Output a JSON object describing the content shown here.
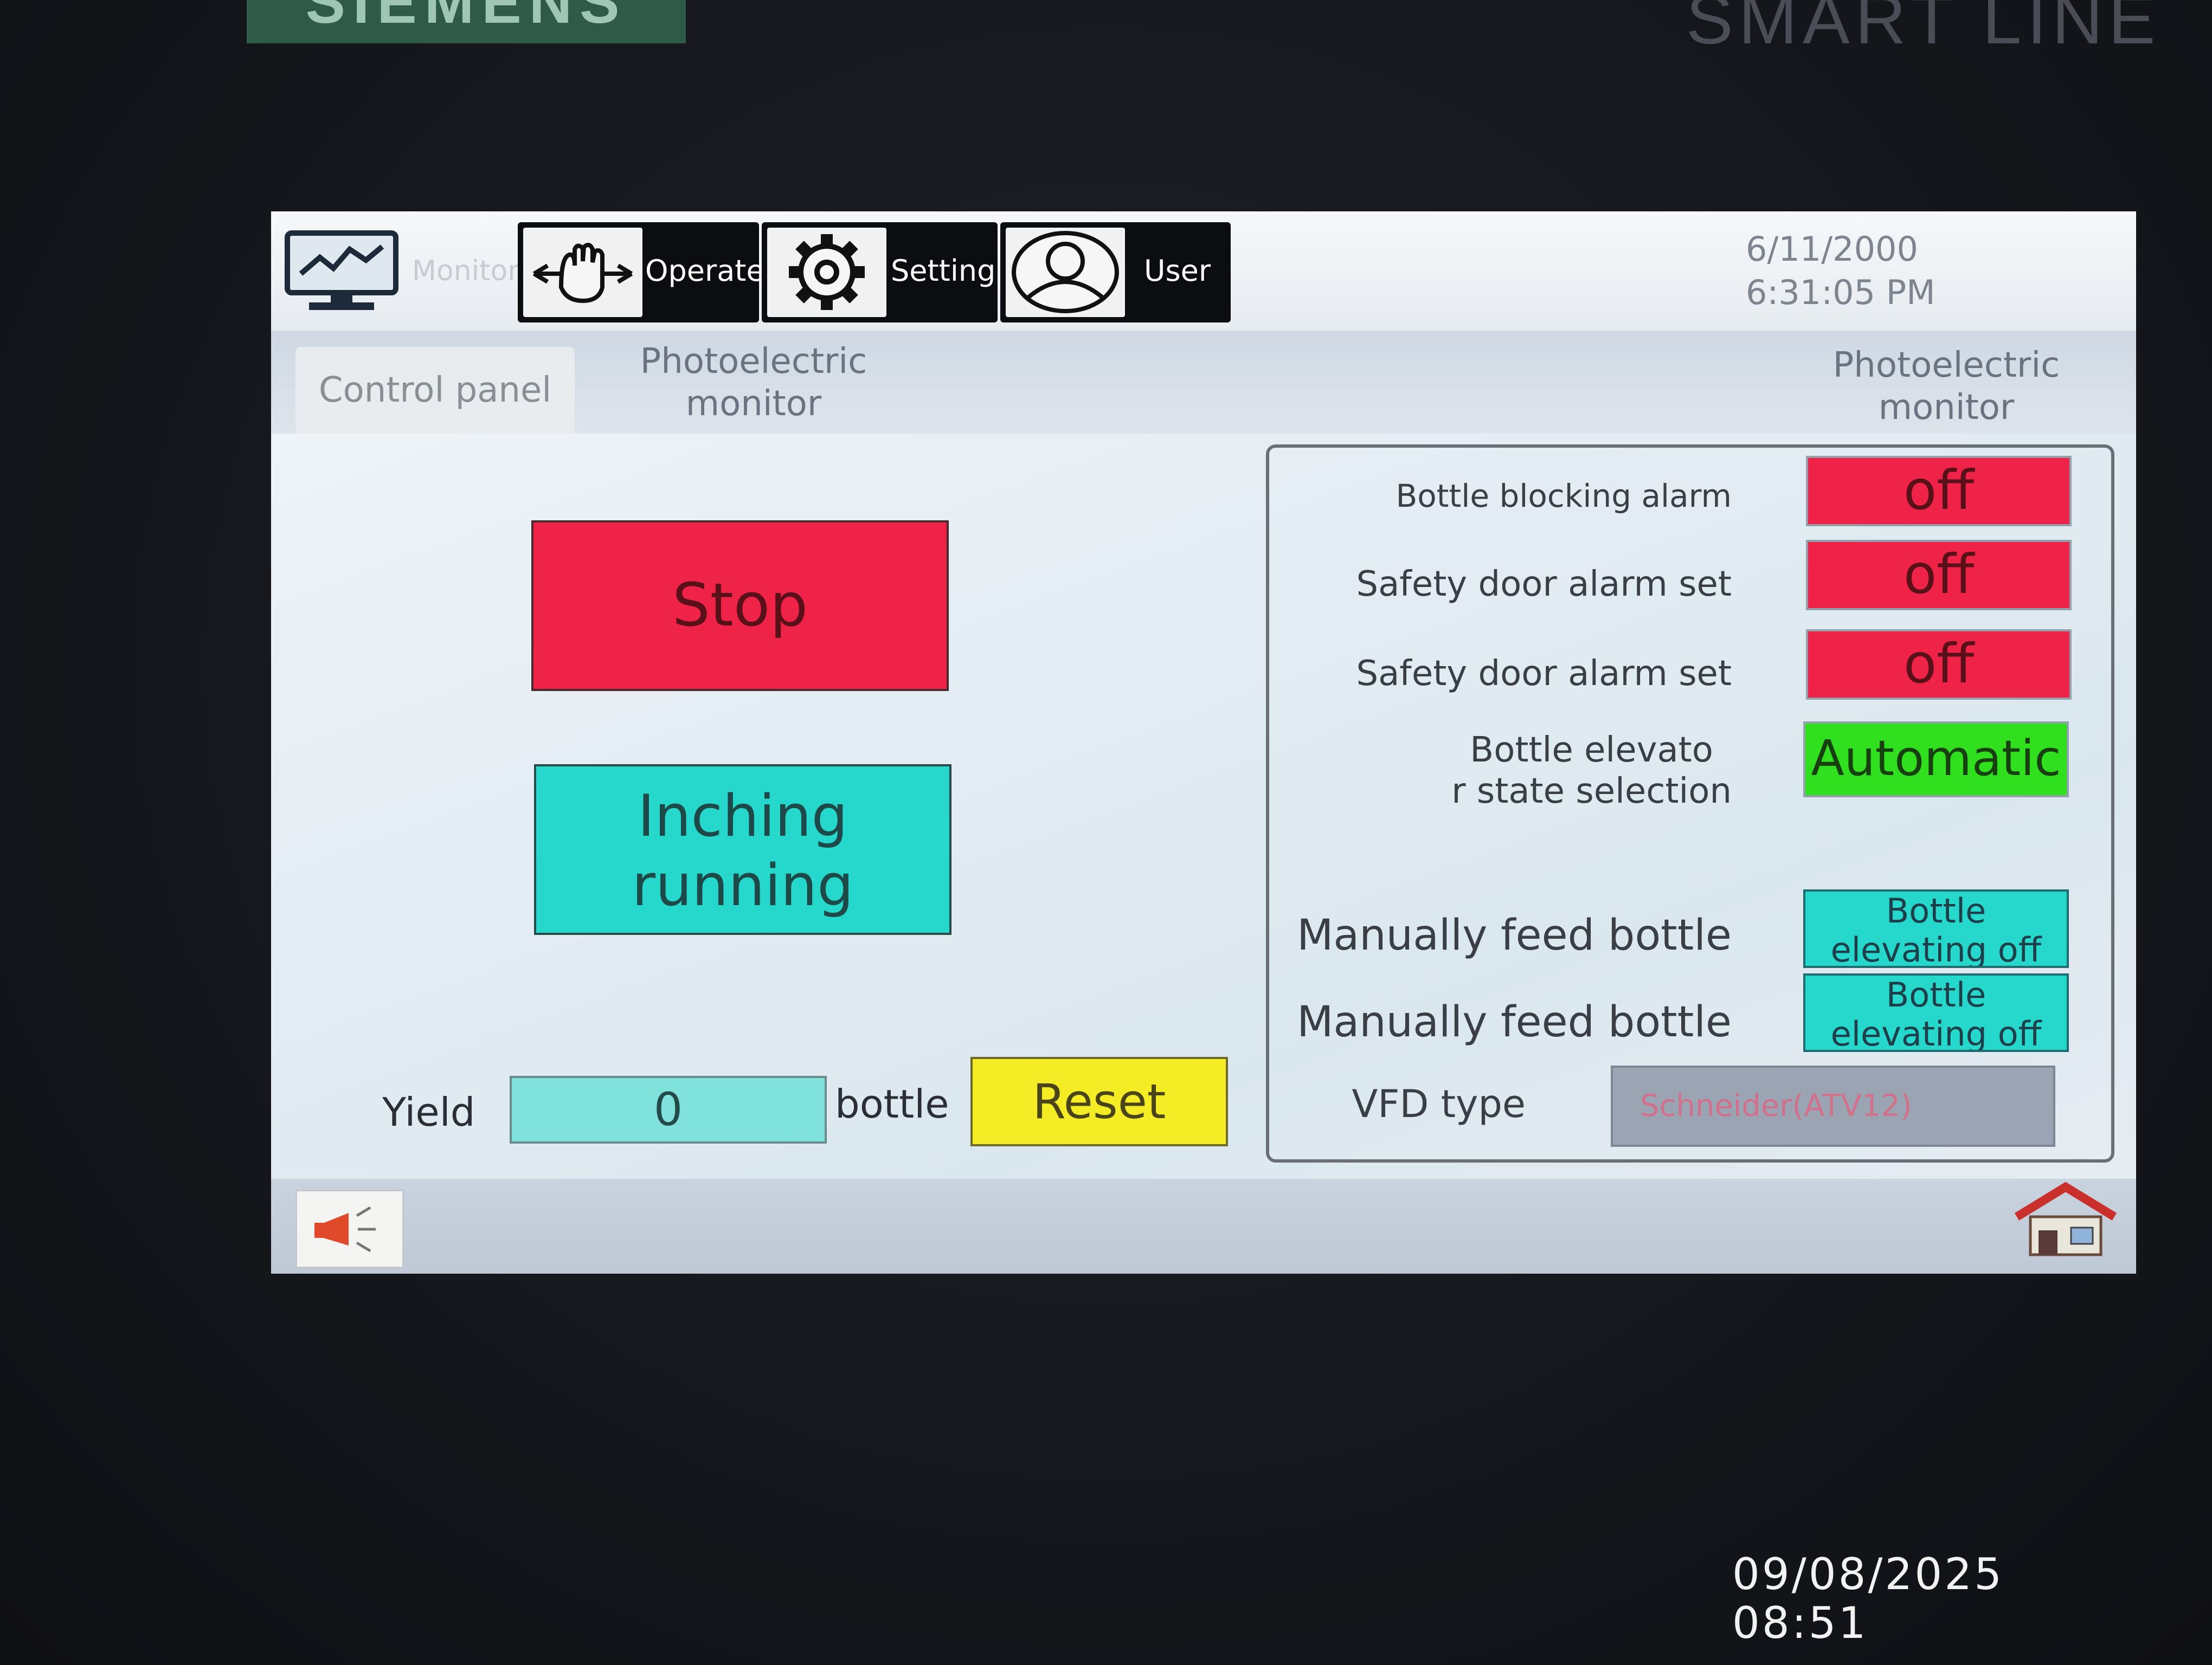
{
  "device": {
    "brand": "SIEMENS",
    "line": "SMART LINE"
  },
  "photo_timestamp": "09/08/2025 08:51",
  "nav": {
    "monitor": {
      "label": "Monitor",
      "icon": "monitor-chart-icon"
    },
    "operate": {
      "label": "Operate",
      "icon": "hand-icon"
    },
    "setting": {
      "label": "Setting",
      "icon": "gear-icon"
    },
    "user": {
      "label": "User",
      "icon": "user-icon"
    }
  },
  "datetime": {
    "date": "6/11/2000",
    "time": "6:31:05 PM"
  },
  "tabs": [
    {
      "label": "Control panel",
      "active": true
    },
    {
      "label": "Photoelectric monitor",
      "active": false
    },
    {
      "label": "Photoelectric monitor",
      "active": false
    }
  ],
  "controls": {
    "stop_label": "Stop",
    "inching_label_line1": "Inching",
    "inching_label_line2": "running",
    "yield_label": "Yield",
    "yield_value": "0",
    "yield_unit": "bottle",
    "reset_label": "Reset"
  },
  "status_panel": {
    "rows": [
      {
        "label": "Bottle blocking alarm",
        "value": "off"
      },
      {
        "label": "Safety door alarm set",
        "value": "off"
      },
      {
        "label": "Safety door alarm set",
        "value": "off"
      }
    ],
    "elevator": {
      "label_line1": "Bottle elevato",
      "label_line2": "r state selection",
      "value": "Automatic"
    },
    "manual_feed": [
      {
        "label": "Manually feed bottle",
        "value_line1": "Bottle",
        "value_line2": "elevating off"
      },
      {
        "label": "Manually feed bottle",
        "value_line1": "Bottle",
        "value_line2": "elevating off"
      }
    ],
    "vfd": {
      "label": "VFD type",
      "value": "Schneider(ATV12)"
    }
  },
  "bottom": {
    "alarm_icon": "megaphone-icon",
    "home_icon": "home-icon"
  },
  "colors": {
    "stop": "#ef2348",
    "inching": "#26d7cc",
    "reset": "#f4ec24",
    "off_state": "#ef2348",
    "automatic_state": "#30e01e",
    "elevating_state": "#26d7cc"
  }
}
